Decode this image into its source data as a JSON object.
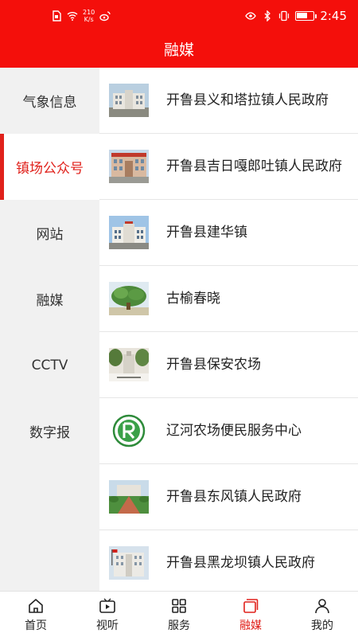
{
  "status_bar": {
    "net_speed": "210",
    "net_unit": "K/s",
    "time": "2:45",
    "battery": "68",
    "battery_level": 0.68
  },
  "header": {
    "title": "融媒"
  },
  "sidebar": {
    "items": [
      {
        "label": "气象信息",
        "active": false
      },
      {
        "label": "镇场公众号",
        "active": true
      },
      {
        "label": "网站",
        "active": false
      },
      {
        "label": "融媒",
        "active": false
      },
      {
        "label": "CCTV",
        "active": false
      },
      {
        "label": "数字报",
        "active": false
      }
    ]
  },
  "list": {
    "items": [
      {
        "label": "开鲁县义和塔拉镇人民政府",
        "thumb": "government-building-photo"
      },
      {
        "label": "开鲁县吉日嘎郎吐镇人民政府",
        "thumb": "government-building-photo"
      },
      {
        "label": "开鲁县建华镇",
        "thumb": "town-building-photo"
      },
      {
        "label": "古榆春晓",
        "thumb": "elm-tree-photo"
      },
      {
        "label": "开鲁县保安农场",
        "thumb": "farm-entrance-photo"
      },
      {
        "label": "辽河农场便民服务中心",
        "thumb": "green-circle-logo"
      },
      {
        "label": "开鲁县东风镇人民政府",
        "thumb": "government-square-photo"
      },
      {
        "label": "开鲁县黑龙坝镇人民政府",
        "thumb": "government-building-photo"
      }
    ]
  },
  "bottom_nav": {
    "items": [
      {
        "label": "首页",
        "icon": "home-icon",
        "active": false
      },
      {
        "label": "视听",
        "icon": "video-icon",
        "active": false
      },
      {
        "label": "服务",
        "icon": "grid-icon",
        "active": false
      },
      {
        "label": "融媒",
        "icon": "media-icon",
        "active": true
      },
      {
        "label": "我的",
        "icon": "user-icon",
        "active": false
      }
    ]
  },
  "colors": {
    "brand_red": "#f40f0b",
    "active_red": "#e0211b",
    "sidebar_bg": "#f1f1f1"
  }
}
